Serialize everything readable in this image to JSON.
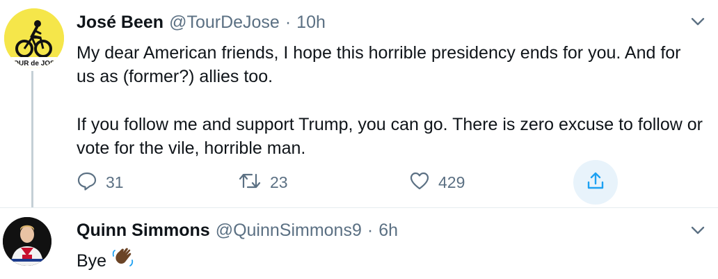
{
  "tweets": [
    {
      "author_name": "José Been",
      "handle": "@TourDeJose",
      "separator": "·",
      "time": "10h",
      "avatar_text": "OUR de JOS",
      "paragraphs": [
        "My dear American friends, I hope this horrible presidency ends for you. And for us as (former?) allies too.",
        "If you follow me and support Trump, you can go. There is zero excuse to follow or vote for the vile, horrible man."
      ],
      "actions": {
        "replies": "31",
        "retweets": "23",
        "likes": "429"
      }
    },
    {
      "author_name": "Quinn Simmons",
      "handle": "@QuinnSimmons9",
      "separator": "·",
      "time": "6h",
      "text": "Bye",
      "emoji": "waving-hand-dark-skin-tone"
    }
  ],
  "colors": {
    "text": "#0f1419",
    "secondary": "#5b7083",
    "accent": "#1da1f2",
    "share_bg": "#e8f3fb",
    "thread_line": "#c4cfd6"
  },
  "icons": [
    "chevron-down-icon",
    "reply-icon",
    "retweet-icon",
    "like-icon",
    "share-icon"
  ]
}
